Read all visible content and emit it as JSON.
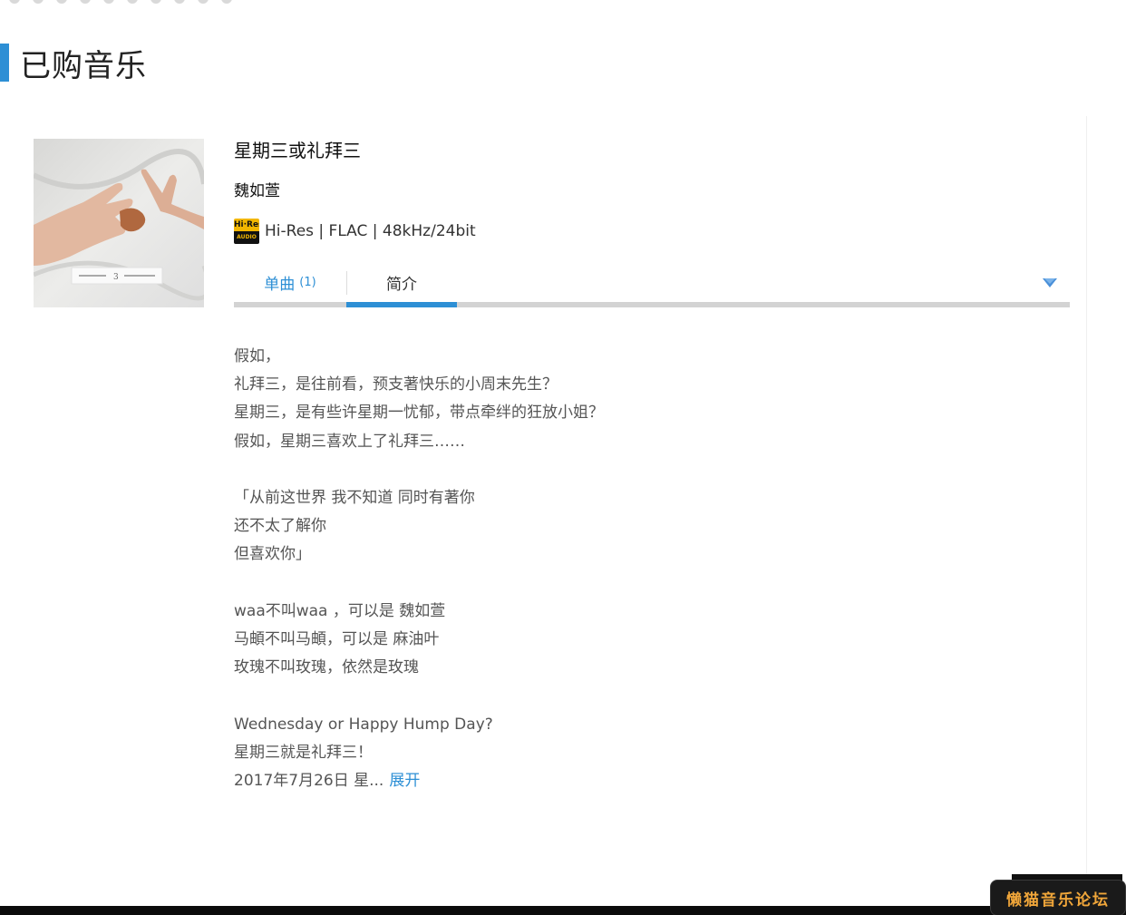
{
  "page": {
    "section_title": "已购音乐"
  },
  "album": {
    "title": "星期三或礼拜三",
    "artist": "魏如萱",
    "badge": {
      "top": "Hi·Res",
      "bottom": "AUDIO"
    },
    "quality": "Hi-Res | FLAC | 48kHz/24bit",
    "cover_icon": "album-cover-hands"
  },
  "tabs": {
    "tracks_label": "单曲",
    "tracks_count": "(1)",
    "intro_label": "简介",
    "active": "intro",
    "expand_icon": "triangle-down-icon"
  },
  "description": {
    "lines": [
      "假如，",
      "礼拜三，是往前看，预支著快乐的小周末先生？",
      "星期三，是有些许星期一忧郁，带点牵绊的狂放小姐？",
      "假如，星期三喜欢上了礼拜三……",
      "",
      "「从前这世界 我不知道 同时有著你",
      "还不太了解你",
      "但喜欢你」",
      "",
      "waa不叫waa ，可以是 魏如萱",
      "马頔不叫马頔，可以是 麻油叶",
      "玫瑰不叫玫瑰，依然是玫瑰",
      "",
      "Wednesday or Happy Hump Day?",
      "星期三就是礼拜三！",
      "2017年7月26日 星..."
    ],
    "expand_label": "展开"
  },
  "watermark": "懒猫音乐论坛",
  "colors": {
    "accent": "#2d8fd5",
    "rail": "#d3d3d3",
    "badge_gold": "#f2b600",
    "watermark_text": "#f0a63a"
  }
}
